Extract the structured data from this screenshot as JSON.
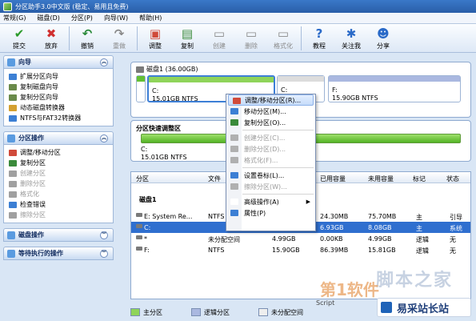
{
  "window": {
    "title": "分区助手3.0中文版 (稳定、易用且免费)"
  },
  "menu": [
    "常规(G)",
    "磁盘(D)",
    "分区(P)",
    "向导(W)",
    "帮助(H)"
  ],
  "toolbar": [
    {
      "label": "提交",
      "icon": "check-icon",
      "color": "#2a9a2a",
      "glyph": "✔",
      "enabled": true
    },
    {
      "label": "放弃",
      "icon": "cancel-icon",
      "color": "#d03030",
      "glyph": "✖",
      "enabled": true
    },
    {
      "label": "撤销",
      "icon": "undo-icon",
      "color": "#2a8a3a",
      "glyph": "↶",
      "enabled": true
    },
    {
      "label": "重做",
      "icon": "redo-icon",
      "color": "#8a8a8a",
      "glyph": "↷",
      "enabled": false
    },
    {
      "label": "调整",
      "icon": "resize-icon",
      "color": "#d04a3a",
      "glyph": "▣",
      "enabled": true
    },
    {
      "label": "复制",
      "icon": "copy-icon",
      "color": "#3a8a3a",
      "glyph": "▤",
      "enabled": true
    },
    {
      "label": "创建",
      "icon": "create-icon",
      "color": "#8a8a8a",
      "glyph": "▭",
      "enabled": false
    },
    {
      "label": "删除",
      "icon": "delete-icon",
      "color": "#8a8a8a",
      "glyph": "▭",
      "enabled": false
    },
    {
      "label": "格式化",
      "icon": "format-icon",
      "color": "#8a8a8a",
      "glyph": "▭",
      "enabled": false
    },
    {
      "label": "教程",
      "icon": "help-icon",
      "color": "#2a6ac8",
      "glyph": "?",
      "enabled": true
    },
    {
      "label": "关注我",
      "icon": "follow-icon",
      "color": "#2a6ac8",
      "glyph": "✱",
      "enabled": true
    },
    {
      "label": "分享",
      "icon": "share-icon",
      "color": "#2a6ac8",
      "glyph": "☻",
      "enabled": true
    }
  ],
  "sidebar": {
    "wizard": {
      "title": "向导",
      "items": [
        {
          "label": "扩展分区向导",
          "icon": "extend-partition-icon",
          "color": "#3c7fd4",
          "enabled": true
        },
        {
          "label": "复制磁盘向导",
          "icon": "copy-disk-icon",
          "color": "#6a8a4a",
          "enabled": true
        },
        {
          "label": "复制分区向导",
          "icon": "copy-partition-icon",
          "color": "#6a8a4a",
          "enabled": true
        },
        {
          "label": "动态磁盘转换器",
          "icon": "dynamic-disk-icon",
          "color": "#d4a030",
          "enabled": true
        },
        {
          "label": "NTFS与FAT32转换器",
          "icon": "ntfs-fat32-icon",
          "color": "#3c7fd4",
          "enabled": true
        }
      ]
    },
    "partition_ops": {
      "title": "分区操作",
      "items": [
        {
          "label": "调整/移动分区",
          "icon": "resize-move-icon",
          "color": "#d04a3a",
          "enabled": true
        },
        {
          "label": "复制分区",
          "icon": "copy-partition-icon",
          "color": "#3a8a3a",
          "enabled": true
        },
        {
          "label": "创建分区",
          "icon": "create-partition-icon",
          "color": "#a0a0a0",
          "enabled": false
        },
        {
          "label": "删除分区",
          "icon": "delete-partition-icon",
          "color": "#a0a0a0",
          "enabled": false
        },
        {
          "label": "格式化",
          "icon": "format-icon",
          "color": "#a0a0a0",
          "enabled": false
        },
        {
          "label": "检查错误",
          "icon": "check-error-icon",
          "color": "#3c7fd4",
          "enabled": true
        },
        {
          "label": "擦除分区",
          "icon": "wipe-partition-icon",
          "color": "#a0a0a0",
          "enabled": false
        }
      ]
    },
    "disk_ops": {
      "title": "磁盘操作"
    },
    "pending_ops": {
      "title": "等待执行的操作"
    }
  },
  "disk_map": {
    "title": "磁盘1 (36.00GB)",
    "segments": [
      {
        "label": "",
        "size": "",
        "bar": "#64c034"
      },
      {
        "label": "C:",
        "size": "15.01GB NTFS",
        "bar": "#8fd45a"
      },
      {
        "label": "C:",
        "size": "",
        "bar": "#dcdcdc"
      },
      {
        "label": "F:",
        "size": "15.90GB NTFS",
        "bar": "#aab8e0"
      }
    ]
  },
  "resize": {
    "title": "分区快速调整区",
    "label": "C:",
    "size": "15.01GB NTFS"
  },
  "table": {
    "headers": [
      "分区",
      "文件",
      "已用容量",
      "未用容量",
      "标记",
      "状态"
    ],
    "group_label": "磁盘1",
    "rows": [
      {
        "name": "E:  System Re...",
        "fs": "NTFS",
        "used": "24.30MB",
        "free": "75.70MB",
        "flag": "主",
        "status": "引导",
        "selected": false
      },
      {
        "name": "C:",
        "fs": "",
        "used": "6.93GB",
        "free": "8.08GB",
        "flag": "主",
        "status": "系统",
        "selected": true
      },
      {
        "name": "*",
        "fs": "未分配空间",
        "cap": "4.99GB",
        "used": "0.00KB",
        "free": "4.99GB",
        "flag": "逻辑",
        "status": "无",
        "selected": false
      },
      {
        "name": "F:",
        "fs": "NTFS",
        "cap": "15.90GB",
        "used": "86.39MB",
        "free": "15.81GB",
        "flag": "逻辑",
        "status": "无",
        "selected": false
      }
    ]
  },
  "context_menu": {
    "items": [
      {
        "label": "调整/移动分区(R)...",
        "icon": "resize-move-icon",
        "color": "#d04a3a",
        "enabled": true,
        "highlight": true
      },
      {
        "label": "移动分区(M)...",
        "icon": "move-partition-icon",
        "color": "#3c7fd4",
        "enabled": true
      },
      {
        "label": "复制分区(O)...",
        "icon": "copy-partition-icon",
        "color": "#3a8a3a",
        "enabled": true
      },
      {
        "sep": true
      },
      {
        "label": "创建分区(C)...",
        "icon": "create-partition-icon",
        "color": "#b0b0b0",
        "enabled": false
      },
      {
        "label": "删除分区(D)...",
        "icon": "delete-partition-icon",
        "color": "#b0b0b0",
        "enabled": false
      },
      {
        "label": "格式化(F)...",
        "icon": "format-icon",
        "color": "#b0b0b0",
        "enabled": false
      },
      {
        "sep": true
      },
      {
        "label": "设置卷标(L)...",
        "icon": "label-icon",
        "color": "#3c7fd4",
        "enabled": true
      },
      {
        "label": "擦除分区(W)...",
        "icon": "wipe-partition-icon",
        "color": "#b0b0b0",
        "enabled": false
      },
      {
        "sep": true
      },
      {
        "label": "高级操作(A)",
        "icon": "advanced-icon",
        "color": "#ffffff",
        "enabled": true,
        "submenu": true
      },
      {
        "label": "属性(P)",
        "icon": "properties-icon",
        "color": "#3c7fd4",
        "enabled": true
      }
    ]
  },
  "legend": [
    {
      "label": "主分区",
      "color": "#8fd45a"
    },
    {
      "label": "逻辑分区",
      "color": "#aab8e0"
    },
    {
      "label": "未分配空间",
      "color": "#eeeeee"
    }
  ],
  "watermark": {
    "site": "易采站长站",
    "brand": "脚本之家",
    "brand2": "第1软件",
    "script": "Script"
  }
}
